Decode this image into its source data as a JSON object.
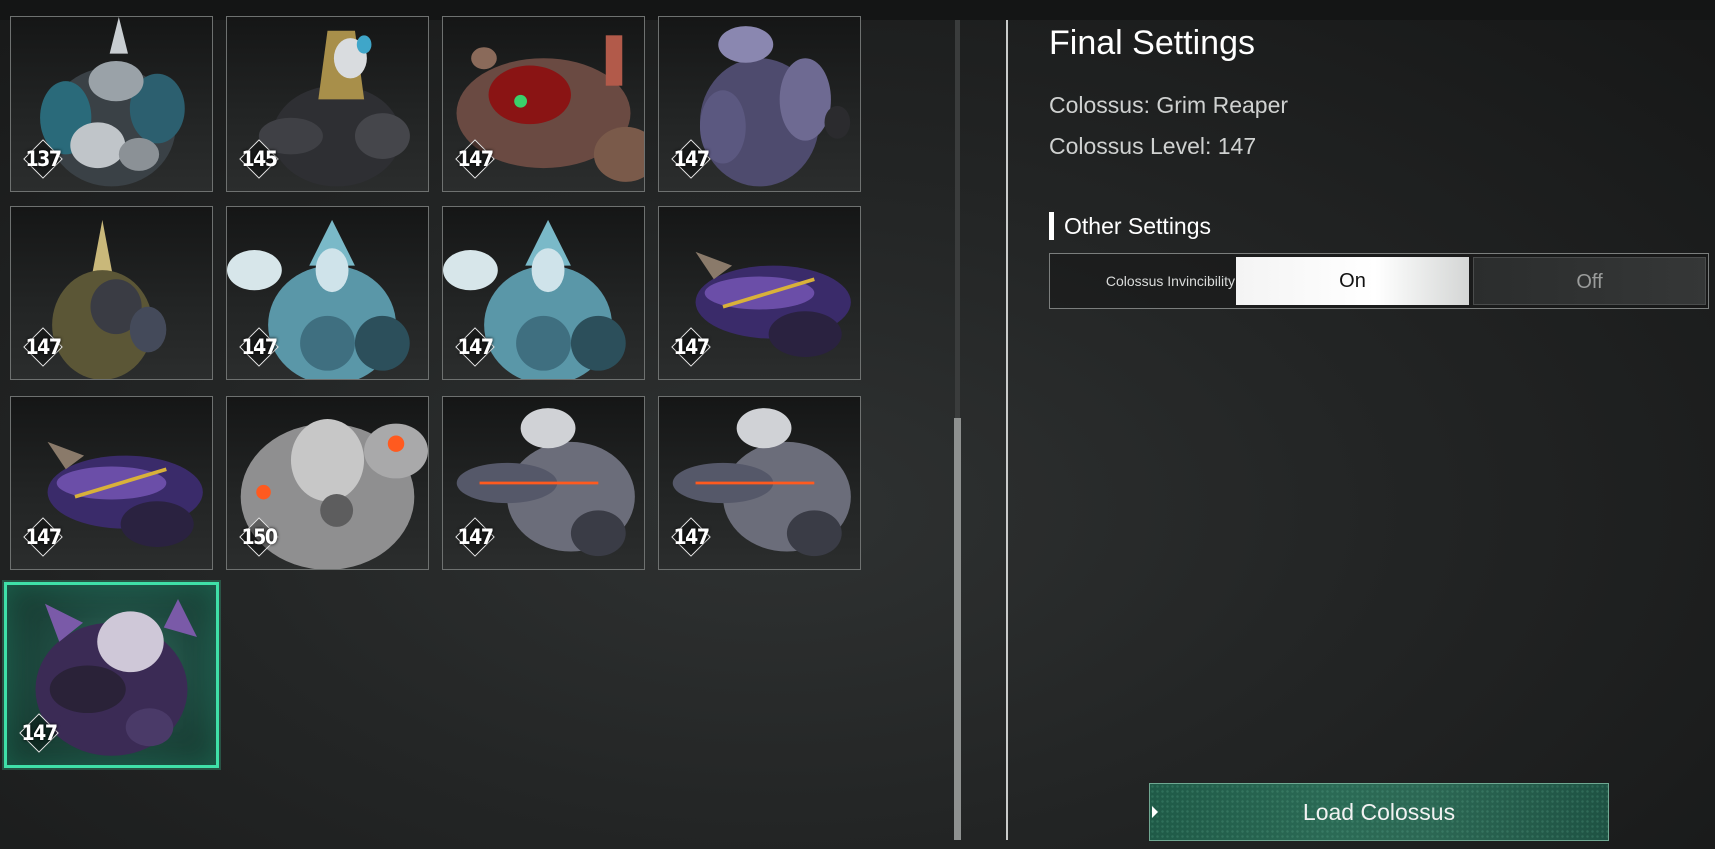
{
  "colossi": [
    {
      "name": "colossus-card-1",
      "level": "137",
      "variant": "dark-mech-teal"
    },
    {
      "name": "colossus-card-2",
      "level": "145",
      "variant": "gold-skeleton"
    },
    {
      "name": "colossus-card-3",
      "level": "147",
      "variant": "red-flesh"
    },
    {
      "name": "colossus-card-4",
      "level": "147",
      "variant": "purple-beast"
    },
    {
      "name": "colossus-card-5",
      "level": "147",
      "variant": "spire-serpent"
    },
    {
      "name": "colossus-card-6",
      "level": "147",
      "variant": "ice-queen"
    },
    {
      "name": "colossus-card-7",
      "level": "147",
      "variant": "ice-queen"
    },
    {
      "name": "colossus-card-8",
      "level": "147",
      "variant": "purple-dragon"
    },
    {
      "name": "colossus-card-9",
      "level": "147",
      "variant": "purple-dragon"
    },
    {
      "name": "colossus-card-10",
      "level": "150",
      "variant": "white-mech-orange"
    },
    {
      "name": "colossus-card-11",
      "level": "147",
      "variant": "gray-wolf"
    },
    {
      "name": "colossus-card-12",
      "level": "147",
      "variant": "gray-wolf"
    },
    {
      "name": "colossus-card-13",
      "level": "147",
      "variant": "grim-reaper",
      "selected": true
    }
  ],
  "panel": {
    "title": "Final Settings",
    "colossus_line": "Colossus: Grim Reaper",
    "level_line": "Colossus Level: 147",
    "other_settings": "Other Settings",
    "invincibility_label": "Colossus Invincibility",
    "option_on": "On",
    "option_off": "Off",
    "selected_option": "On",
    "load_button": "Load Colossus"
  },
  "colors": {
    "selected_border": "#3fe0a8",
    "load_button_bg": "#2b6a55"
  }
}
